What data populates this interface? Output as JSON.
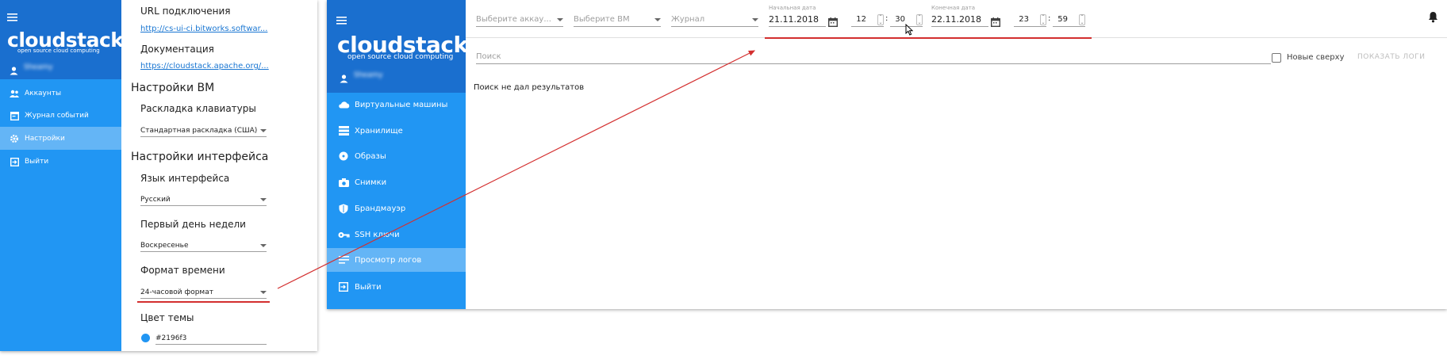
{
  "left_app": {
    "logo": "cloudstack",
    "logo_sub": "open source cloud computing",
    "username": "Sheamy",
    "nav": [
      {
        "label": "Аккаунты",
        "icon": "accounts-icon"
      },
      {
        "label": "Журнал событий",
        "icon": "event-log-icon"
      },
      {
        "label": "Настройки",
        "icon": "gear-icon"
      },
      {
        "label": "Выйти",
        "icon": "logout-icon"
      }
    ],
    "settings": {
      "url_label": "URL подключения",
      "url_value": "http://cs-ui-ci.bitworks.softwar...",
      "docs_label": "Документация",
      "docs_value": "https://cloudstack.apache.org/...",
      "vm_section": "Настройки ВМ",
      "keyboard_label": "Раскладка клавиатуры",
      "keyboard_value": "Стандартная раскладка (США)",
      "ui_section": "Настройки интерфейса",
      "language_label": "Язык интерфейса",
      "language_value": "Русский",
      "first_day_label": "Первый день недели",
      "first_day_value": "Воскресенье",
      "time_format_label": "Формат времени",
      "time_format_value": "24-часовой формат",
      "theme_color_label": "Цвет темы",
      "theme_color_value": "#2196f3"
    }
  },
  "right_app": {
    "logo": "cloudstack",
    "logo_sub": "open source cloud computing",
    "username": "Sheamy",
    "nav": [
      {
        "label": "Виртуальные машины",
        "icon": "cloud-icon"
      },
      {
        "label": "Хранилище",
        "icon": "storage-icon"
      },
      {
        "label": "Образы",
        "icon": "disc-icon"
      },
      {
        "label": "Снимки",
        "icon": "camera-icon"
      },
      {
        "label": "Брандмауэр",
        "icon": "shield-icon"
      },
      {
        "label": "SSH ключи",
        "icon": "key-icon"
      },
      {
        "label": "Просмотр логов",
        "icon": "logs-icon"
      },
      {
        "label": "Выйти",
        "icon": "logout-icon"
      }
    ],
    "toolbar": {
      "account_placeholder": "Выберите аккау...",
      "vm_placeholder": "Выберите ВМ",
      "journal_placeholder": "Журнал",
      "start_date_label": "Начальная дата",
      "start_date": "21.11.2018",
      "start_hour": "12",
      "start_minute": "30",
      "end_date_label": "Конечная дата",
      "end_date": "22.11.2018",
      "end_hour": "23",
      "end_minute": "59",
      "time_sep": ":"
    },
    "search_placeholder": "Поиск",
    "newest_first_label": "Новые сверху",
    "newest_first_checked": false,
    "show_logs_label": "ПОКАЗАТЬ ЛОГИ",
    "empty_message": "Поиск не дал результатов"
  },
  "colors": {
    "sidebar": "#2196f3",
    "sidebar_header": "#1a6fcf",
    "active_item": "#64b5f6",
    "annotation": "#d32f2f"
  }
}
